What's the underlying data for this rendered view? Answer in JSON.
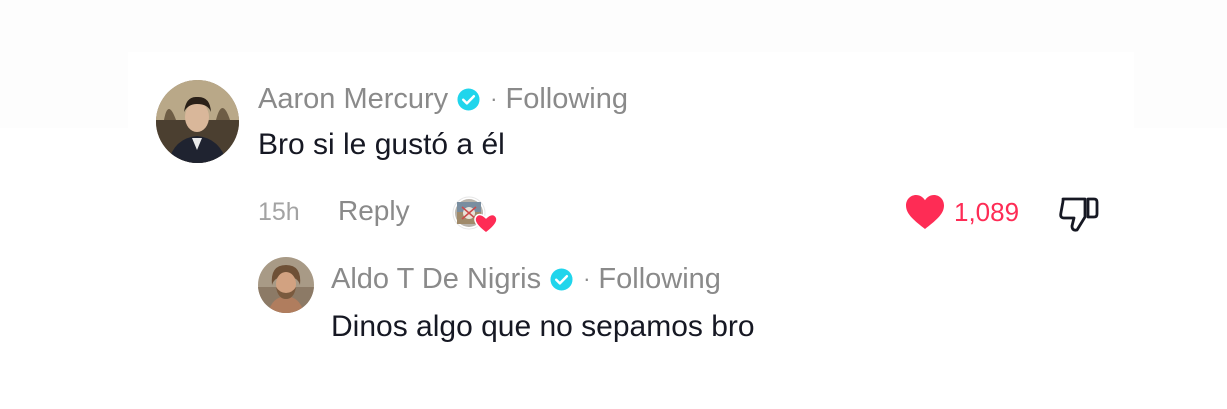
{
  "comment": {
    "author": "Aaron Mercury",
    "separator": "·",
    "follow_status": "Following",
    "text": "Bro si le gustó a él",
    "time": "15h",
    "reply_label": "Reply",
    "like_count": "1,089",
    "liked": true,
    "liked_by_creator": true
  },
  "reply": {
    "author": "Aldo T De Nigris",
    "separator": "·",
    "follow_status": "Following",
    "text": "Dinos algo que no sepamos bro"
  },
  "colors": {
    "verified_badge": "#20d5ec",
    "like_heart": "#fe2c55",
    "primary_text": "#161823",
    "secondary_text": "#8a8a8a"
  },
  "icons": {
    "verified": "verified-badge-icon",
    "creator_liked": "creator-liked-icon",
    "like": "heart-icon",
    "dislike": "thumbs-down-icon"
  }
}
